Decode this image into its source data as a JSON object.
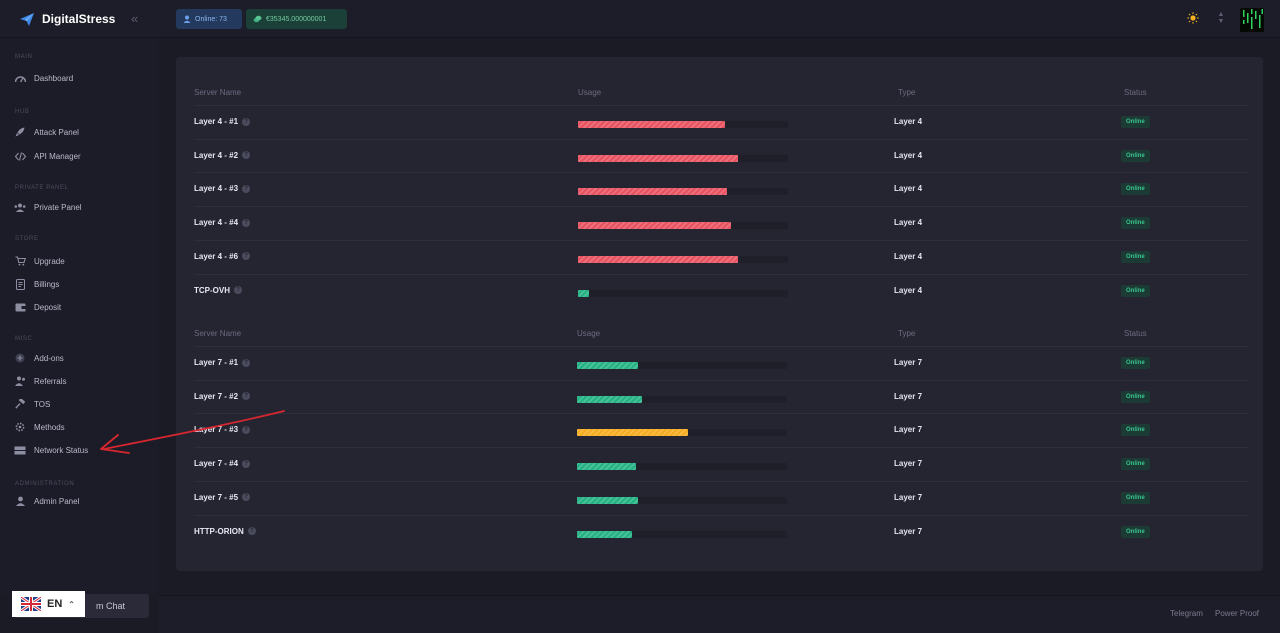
{
  "brand": {
    "name": "DigitalStress"
  },
  "topbar": {
    "online_label": "Online: 73",
    "balance_label": "€35345.000000001"
  },
  "sidebar": {
    "sections": [
      {
        "label": "MAIN"
      },
      {
        "label": "HUB"
      },
      {
        "label": "PRIVATE PANEL"
      },
      {
        "label": "STORE"
      },
      {
        "label": "MISC"
      },
      {
        "label": "ADMINISTRATION"
      }
    ],
    "items": [
      {
        "label": "Dashboard",
        "icon": "dashboard-icon"
      },
      {
        "label": "Attack Panel",
        "icon": "rocket-icon"
      },
      {
        "label": "API Manager",
        "icon": "code-icon"
      },
      {
        "label": "Private Panel",
        "icon": "users-icon"
      },
      {
        "label": "Upgrade",
        "icon": "cart-icon"
      },
      {
        "label": "Billings",
        "icon": "receipt-icon"
      },
      {
        "label": "Deposit",
        "icon": "wallet-icon"
      },
      {
        "label": "Add-ons",
        "icon": "plus-circle-icon"
      },
      {
        "label": "Referrals",
        "icon": "user-group-icon"
      },
      {
        "label": "TOS",
        "icon": "gavel-icon"
      },
      {
        "label": "Methods",
        "icon": "gear-icon"
      },
      {
        "label": "Network Status",
        "icon": "server-icon"
      },
      {
        "label": "Admin Panel",
        "icon": "admin-icon"
      }
    ],
    "chat_label": "m Chat"
  },
  "language": {
    "code": "EN"
  },
  "table": {
    "headers": {
      "name": "Server Name",
      "usage": "Usage",
      "type": "Type",
      "status": "Status"
    },
    "layer4": [
      {
        "name": "Layer 4 - #1",
        "usage": 0.7,
        "color": "#e8515f",
        "type": "Layer 4",
        "status": "Online"
      },
      {
        "name": "Layer 4 - #2",
        "usage": 0.76,
        "color": "#e8515f",
        "type": "Layer 4",
        "status": "Online"
      },
      {
        "name": "Layer 4 - #3",
        "usage": 0.71,
        "color": "#e8515f",
        "type": "Layer 4",
        "status": "Online"
      },
      {
        "name": "Layer 4 - #4",
        "usage": 0.73,
        "color": "#e8515f",
        "type": "Layer 4",
        "status": "Online"
      },
      {
        "name": "Layer 4 - #6",
        "usage": 0.76,
        "color": "#e8515f",
        "type": "Layer 4",
        "status": "Online"
      },
      {
        "name": "TCP-OVH",
        "usage": 0.05,
        "color": "#22b283",
        "type": "Layer 4",
        "status": "Online"
      }
    ],
    "layer7": [
      {
        "name": "Layer 7 - #1",
        "usage": 0.29,
        "color": "#22b283",
        "type": "Layer 7",
        "status": "Online"
      },
      {
        "name": "Layer 7 - #2",
        "usage": 0.31,
        "color": "#22b283",
        "type": "Layer 7",
        "status": "Online"
      },
      {
        "name": "Layer 7 - #3",
        "usage": 0.53,
        "color": "#f5ac1e",
        "type": "Layer 7",
        "status": "Online"
      },
      {
        "name": "Layer 7 - #4",
        "usage": 0.28,
        "color": "#22b283",
        "type": "Layer 7",
        "status": "Online"
      },
      {
        "name": "Layer 7 - #5",
        "usage": 0.29,
        "color": "#22b283",
        "type": "Layer 7",
        "status": "Online"
      },
      {
        "name": "HTTP-ORION",
        "usage": 0.26,
        "color": "#22b283",
        "type": "Layer 7",
        "status": "Online"
      }
    ]
  },
  "footer": {
    "links": [
      "Telegram",
      "Power Proof"
    ]
  },
  "annotation": {
    "color": "#d8262e"
  }
}
